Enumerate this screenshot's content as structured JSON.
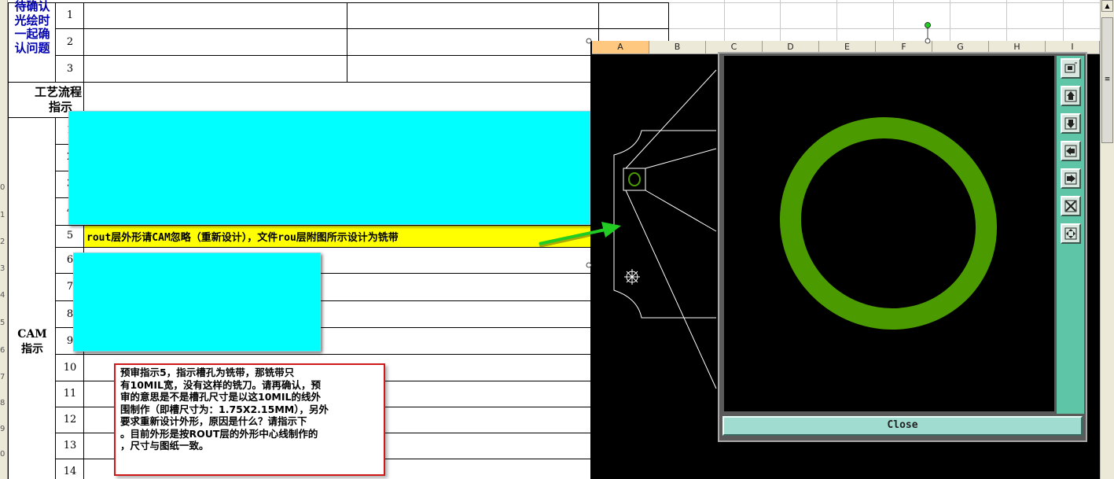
{
  "spreadsheet": {
    "left_rownums": [
      "0",
      "1",
      "2",
      "3",
      "4",
      "5",
      "6",
      "7",
      "8",
      "9",
      "0"
    ],
    "label_pending": "待确认光绘时一起确认问题",
    "label_pending_lines": [
      "待确认",
      "光绘时",
      "一起确",
      "认问题"
    ],
    "label_process_lines": [
      "工艺流程",
      "指示"
    ],
    "label_cam_lines": [
      "CAM",
      "指示"
    ],
    "row_numbers_top": [
      "1",
      "2",
      "3"
    ],
    "row_numbers_cam": [
      "1",
      "2",
      "3",
      "4",
      "5",
      "6",
      "7",
      "8",
      "9",
      "10",
      "11",
      "12",
      "13",
      "14"
    ],
    "highlight_row_text": "rout层外形请CAM忽略（重新设计），文件rou层附图所示设计为铣带"
  },
  "note": {
    "lines": [
      "预审指示5，指示槽孔为铣带，那铣带只",
      "有10MIL宽，没有这样的铣刀。请再确认，预",
      "审的意思是不是槽孔尺寸是以这10MIL的线外",
      "围制作（即槽尺寸为：1.75X2.15MM），另外",
      "要求重新设计外形，原因是什么？请指示下",
      "。目前外形是按ROUT层的外形中心线制作的",
      "，尺寸与图纸一致。"
    ],
    "border_color": "#d01818"
  },
  "column_headers": [
    "A",
    "B",
    "C",
    "D",
    "E",
    "F",
    "G",
    "H",
    "I"
  ],
  "selected_column": "A",
  "cad_viewer": {
    "close_label": "Close",
    "toolbar_icons": [
      "zoom-fit-icon",
      "pan-up-icon",
      "pan-down-icon",
      "pan-left-icon",
      "pan-right-icon",
      "zoom-out-icon",
      "zoom-in-icon"
    ],
    "ring_color": "#4a9a00",
    "outline_color": "#ffffff"
  },
  "colors": {
    "cyan_box": "#00ffff",
    "highlight": "#ffff00",
    "arrow": "#22cc22",
    "blue_text": "#0000b0"
  }
}
